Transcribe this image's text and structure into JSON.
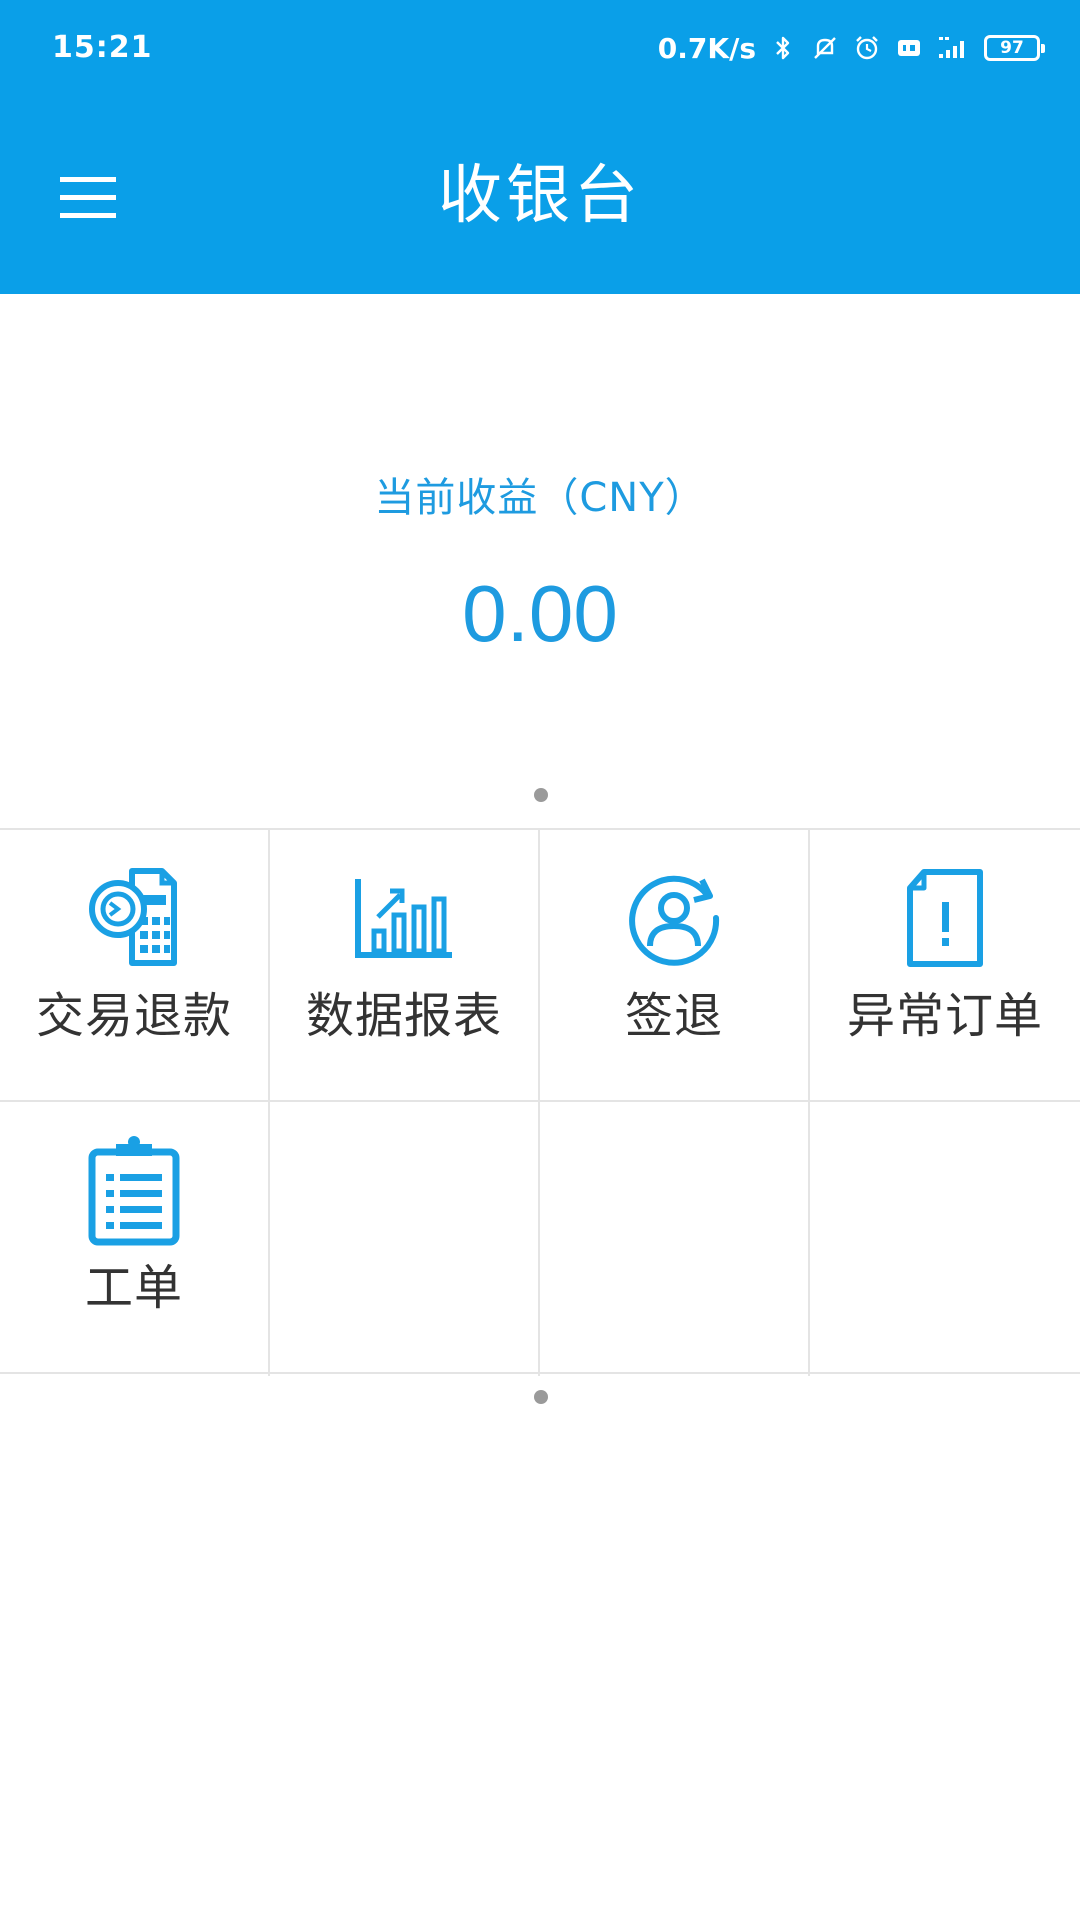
{
  "status_bar": {
    "time": "15:21",
    "net_speed": "0.7K/s",
    "icons": [
      "bluetooth-icon",
      "mute-icon",
      "alarm-icon",
      "hd-icon",
      "signal-icon"
    ],
    "battery": "97"
  },
  "app_bar": {
    "menu_icon": "hamburger-menu-icon",
    "title": "收银台"
  },
  "earnings": {
    "label": "当前收益（CNY）",
    "value": "0.00"
  },
  "functions": [
    {
      "label": "交易退款",
      "icon": "refund-calculator-icon"
    },
    {
      "label": "数据报表",
      "icon": "bar-chart-icon"
    },
    {
      "label": "签退",
      "icon": "user-signout-icon"
    },
    {
      "label": "异常订单",
      "icon": "exception-document-icon"
    },
    {
      "label": "工单",
      "icon": "clipboard-list-icon"
    }
  ],
  "colors": {
    "primary": "#0a9fe8",
    "accent_text": "#1e9be0",
    "icon_blue": "#1aa0e4",
    "label_text": "#333333",
    "grid_line": "#e4e4e4"
  }
}
